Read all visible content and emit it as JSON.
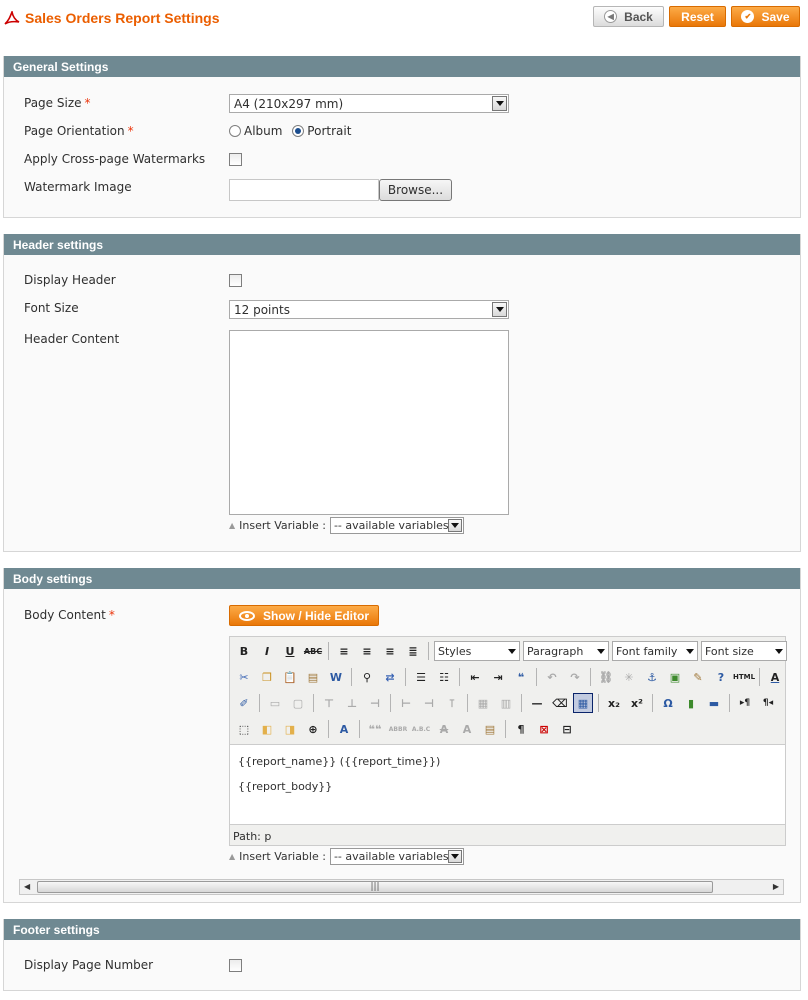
{
  "header": {
    "title": "Sales Orders Report Settings",
    "back_label": "Back",
    "reset_label": "Reset",
    "save_label": "Save"
  },
  "general": {
    "title": "General Settings",
    "page_size_label": "Page Size",
    "page_size_value": "A4 (210x297 mm)",
    "orientation_label": "Page Orientation",
    "orientation_options": [
      "Album",
      "Portrait"
    ],
    "orientation_selected": "Portrait",
    "watermarks_label": "Apply Cross-page Watermarks",
    "watermarks_checked": false,
    "watermark_image_label": "Watermark Image",
    "browse_label": "Browse..."
  },
  "header_settings": {
    "title": "Header settings",
    "display_header_label": "Display Header",
    "display_header_checked": false,
    "font_size_label": "Font Size",
    "font_size_value": "12 points",
    "content_label": "Header Content",
    "content_value": "",
    "insert_variable_label": "Insert Variable :",
    "variable_select_value": "-- available variables --"
  },
  "body_settings": {
    "title": "Body settings",
    "content_label": "Body Content",
    "show_hide_label": "Show / Hide Editor",
    "toolbar": {
      "styles": "Styles",
      "paragraph": "Paragraph",
      "font_family": "Font family",
      "font_size": "Font size"
    },
    "editor_lines": [
      "{{report_name}} ({{report_time}})",
      "{{report_body}}"
    ],
    "path_label": "Path: p",
    "insert_variable_label": "Insert Variable :",
    "variable_select_value": "-- available variables --"
  },
  "footer_settings": {
    "title": "Footer settings",
    "display_page_number_label": "Display Page Number",
    "display_page_number_checked": false
  },
  "colors": {
    "accent": "#eb5e00",
    "section_header": "#6f8992",
    "button_orange": "#f39c2b"
  }
}
